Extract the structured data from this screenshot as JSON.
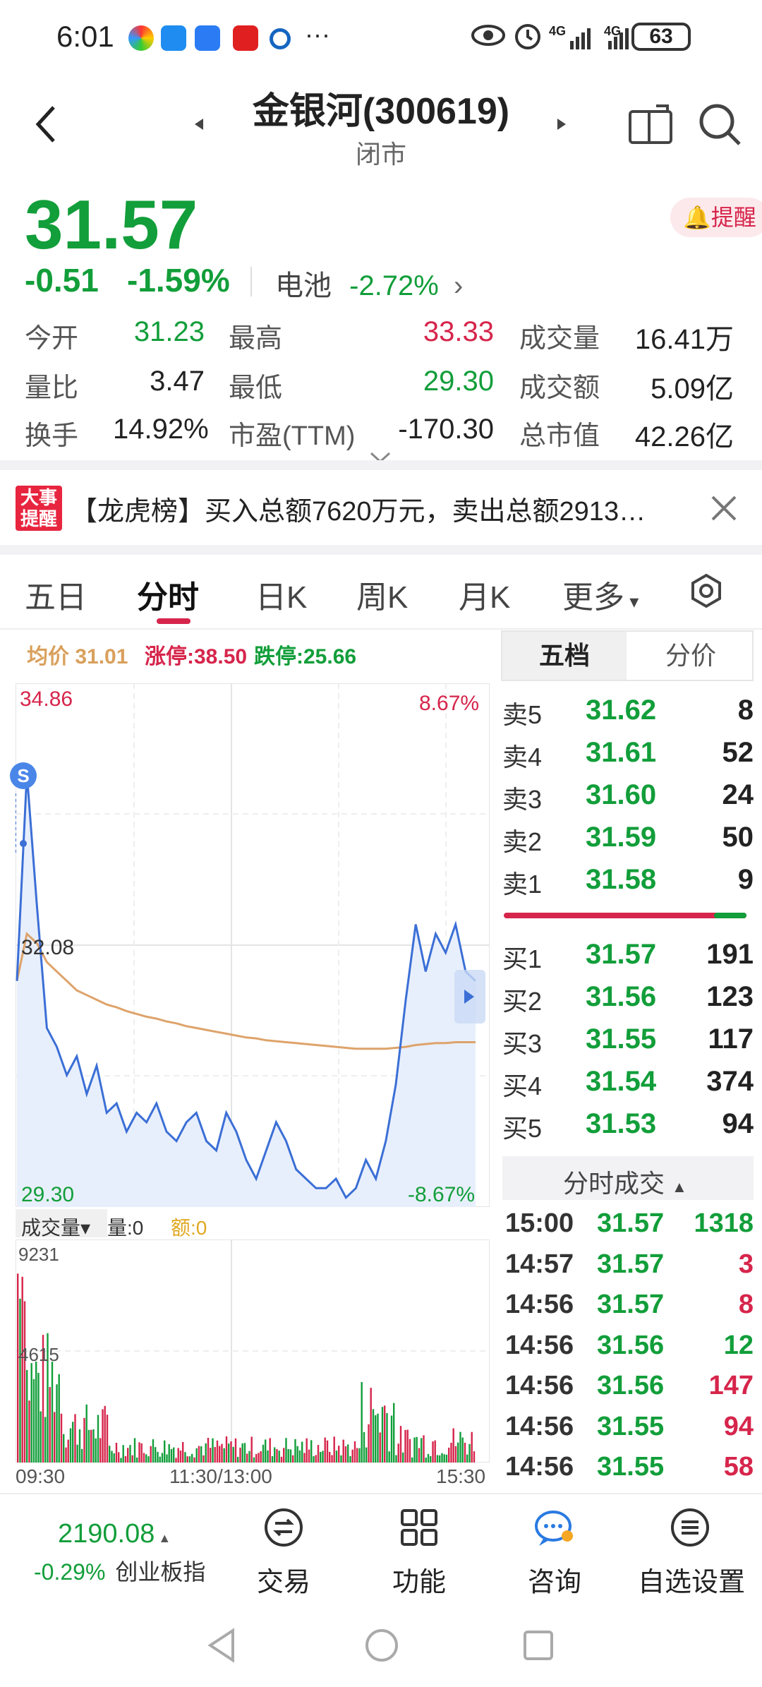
{
  "status_bar": {
    "time": "6:01",
    "net1": "4G",
    "net2": "4G",
    "battery": "63",
    "more": "···"
  },
  "header": {
    "title": "金银河(300619)",
    "subtitle": "闭市"
  },
  "quote": {
    "price": "31.57",
    "change": "-0.51",
    "change_pct": "-1.59%",
    "sector_name": "电池",
    "sector_pct": "-2.72%",
    "remind_label": "提醒"
  },
  "stats": [
    {
      "label": "今开",
      "value": "31.23",
      "color": "green"
    },
    {
      "label": "最高",
      "value": "33.33",
      "color": "red"
    },
    {
      "label": "成交量",
      "value": "16.41万",
      "color": "black"
    },
    {
      "label": "量比",
      "value": "3.47",
      "color": "black"
    },
    {
      "label": "最低",
      "value": "29.30",
      "color": "green"
    },
    {
      "label": "成交额",
      "value": "5.09亿",
      "color": "black"
    },
    {
      "label": "换手",
      "value": "14.92%",
      "color": "black"
    },
    {
      "label": "市盈(TTM)",
      "value": "-170.30",
      "color": "black"
    },
    {
      "label": "总市值",
      "value": "42.26亿",
      "color": "black"
    }
  ],
  "news": {
    "tag_line1": "大事",
    "tag_line2": "提醒",
    "text": "【龙虎榜】买入总额7620万元，卖出总额2913…"
  },
  "tabs": [
    "五日",
    "分时",
    "日K",
    "周K",
    "月K",
    "更多"
  ],
  "chart_header": {
    "avg_label": "均价",
    "avg_value": "31.01",
    "limit_up": "涨停:38.50",
    "limit_down": "跌停:25.66"
  },
  "chart_labels": {
    "top_price": "34.86",
    "top_pct": "8.67%",
    "mid_price": "32.08",
    "bottom_price": "29.30",
    "bottom_pct": "-8.67%",
    "marker": "S",
    "vol_title": "成交量",
    "vol_amount": "量:0",
    "vol_money": "额:0",
    "vol_max": "9231",
    "vol_mid": "4615",
    "time_start": "09:30",
    "time_mid": "11:30/13:00",
    "time_end": "15:30"
  },
  "order_book": {
    "tab_active": "五档",
    "tab_other": "分价",
    "asks": [
      {
        "label": "卖5",
        "price": "31.62",
        "qty": "8"
      },
      {
        "label": "卖4",
        "price": "31.61",
        "qty": "52"
      },
      {
        "label": "卖3",
        "price": "31.60",
        "qty": "24"
      },
      {
        "label": "卖2",
        "price": "31.59",
        "qty": "50"
      },
      {
        "label": "卖1",
        "price": "31.58",
        "qty": "9"
      }
    ],
    "bids": [
      {
        "label": "买1",
        "price": "31.57",
        "qty": "191"
      },
      {
        "label": "买2",
        "price": "31.56",
        "qty": "123"
      },
      {
        "label": "买3",
        "price": "31.55",
        "qty": "117"
      },
      {
        "label": "买4",
        "price": "31.54",
        "qty": "374"
      },
      {
        "label": "买5",
        "price": "31.53",
        "qty": "94"
      }
    ]
  },
  "ticks": {
    "title": "分时成交",
    "rows": [
      {
        "time": "15:00",
        "price": "31.57",
        "vol": "1318",
        "color": "green"
      },
      {
        "time": "14:57",
        "price": "31.57",
        "vol": "3",
        "color": "red"
      },
      {
        "time": "14:56",
        "price": "31.57",
        "vol": "8",
        "color": "red"
      },
      {
        "time": "14:56",
        "price": "31.56",
        "vol": "12",
        "color": "green"
      },
      {
        "time": "14:56",
        "price": "31.56",
        "vol": "147",
        "color": "red"
      },
      {
        "time": "14:56",
        "price": "31.55",
        "vol": "94",
        "color": "red"
      },
      {
        "time": "14:56",
        "price": "31.55",
        "vol": "58",
        "color": "red"
      }
    ]
  },
  "bottom": {
    "index_value": "2190.08",
    "index_pct": "-0.29%",
    "index_name": "创业板指",
    "nav": [
      "交易",
      "功能",
      "咨询",
      "自选设置"
    ]
  },
  "chart_data": {
    "type": "line",
    "ylim": [
      29.3,
      34.86
    ],
    "price": [
      31.7,
      33.9,
      32.5,
      31.2,
      31.0,
      30.7,
      30.9,
      30.5,
      30.8,
      30.3,
      30.4,
      30.1,
      30.3,
      30.2,
      30.4,
      30.1,
      30.0,
      30.2,
      30.3,
      30.0,
      29.9,
      30.3,
      30.1,
      29.8,
      29.6,
      29.9,
      30.2,
      30.0,
      29.7,
      29.6,
      29.5,
      29.5,
      29.6,
      29.4,
      29.5,
      29.8,
      29.6,
      30.0,
      30.6,
      31.5,
      32.3,
      31.8,
      32.2,
      32.0,
      32.3,
      31.8,
      31.7
    ],
    "avg": [
      31.7,
      32.2,
      32.1,
      31.9,
      31.8,
      31.7,
      31.6,
      31.55,
      31.5,
      31.45,
      31.42,
      31.38,
      31.35,
      31.32,
      31.3,
      31.27,
      31.25,
      31.22,
      31.2,
      31.18,
      31.16,
      31.14,
      31.12,
      31.1,
      31.09,
      31.07,
      31.06,
      31.05,
      31.04,
      31.03,
      31.02,
      31.01,
      31.0,
      30.99,
      30.98,
      30.98,
      30.98,
      30.98,
      30.99,
      31.0,
      31.02,
      31.03,
      31.04,
      31.04,
      31.05,
      31.05,
      31.05
    ],
    "volume_max": 9231
  }
}
